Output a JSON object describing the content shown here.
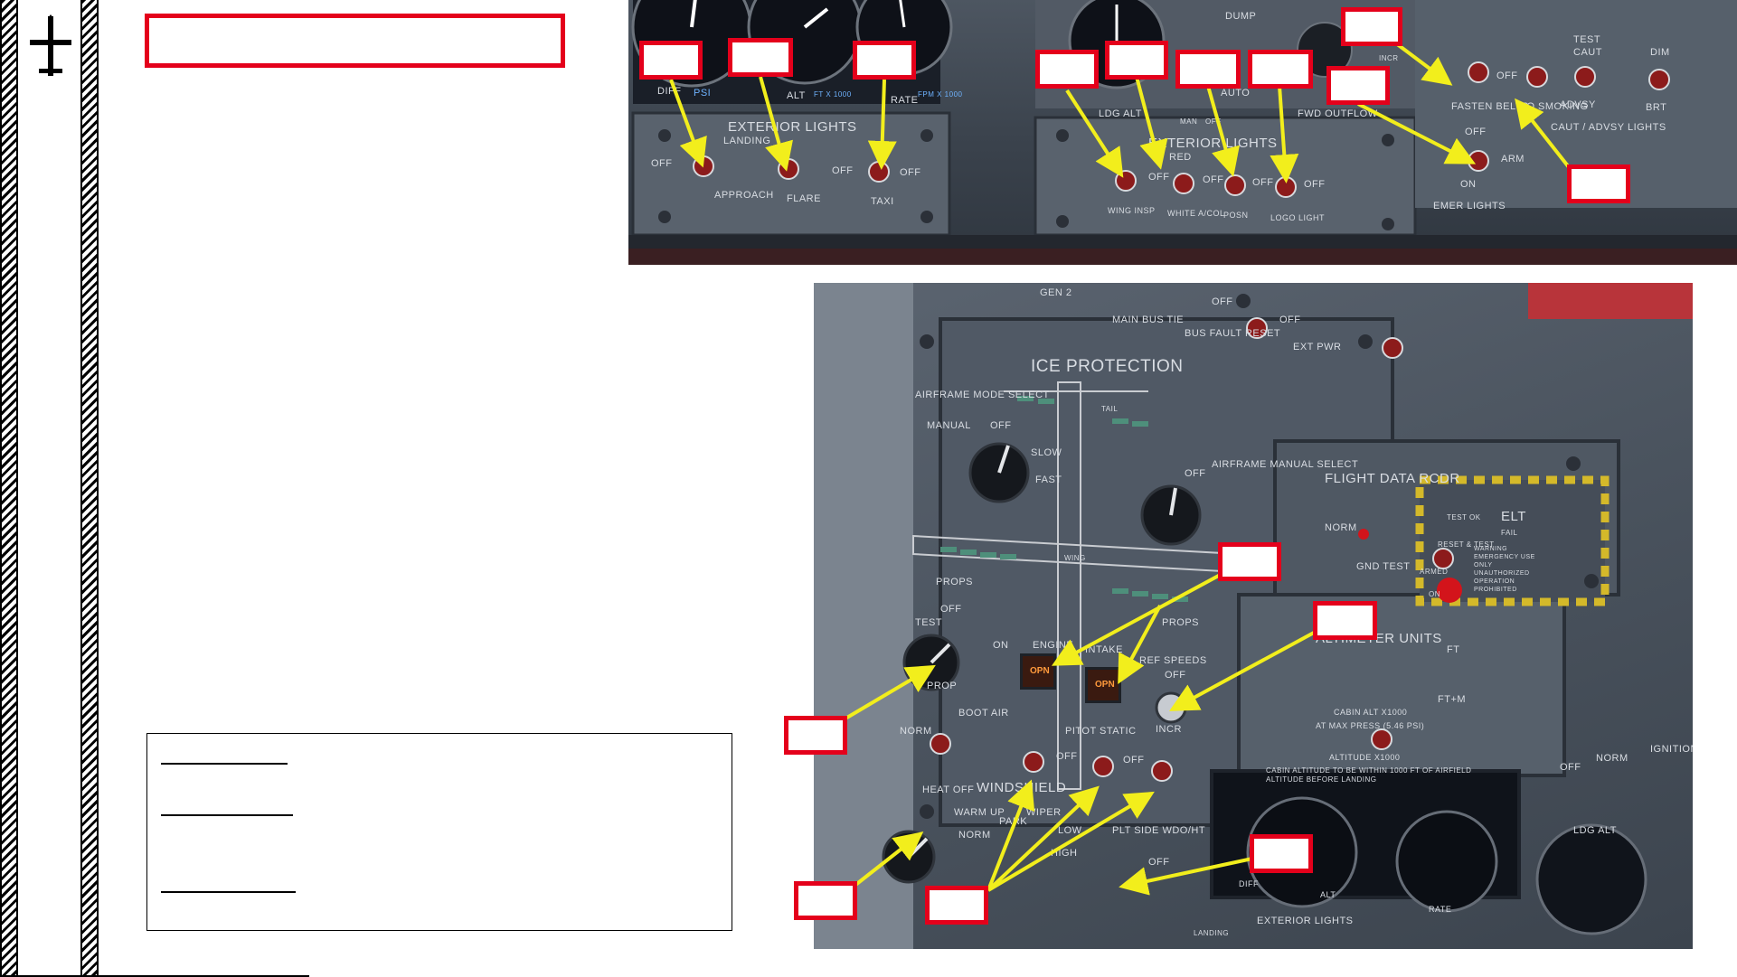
{
  "page": {
    "logo_icon": "airplane-icon"
  },
  "panel_top": {
    "gauges": {
      "gauge1_unit": "PSI",
      "gauge1_diff": "DIFF",
      "gauge2_label": "ALT",
      "gauge2_unit": "FT X 1000",
      "gauge3_label": "RATE",
      "gauge3_unit": "FPM X 1000"
    },
    "exterior_lights_left": {
      "title": "EXTERIOR LIGHTS",
      "landing": "LANDING",
      "off1": "OFF",
      "approach": "APPROACH",
      "flare": "FLARE",
      "off2": "OFF",
      "off3": "OFF",
      "taxi": "TAXI"
    },
    "cabin_pressure": {
      "dump": "DUMP",
      "auto": "AUTO",
      "man": "MAN",
      "off": "OFF",
      "ldg_alt": "LDG ALT",
      "fwd_outflow": "FWD OUTFLOW",
      "incr": "INCR"
    },
    "exterior_lights_right": {
      "title": "EXTERIOR LIGHTS",
      "red": "RED",
      "off1": "OFF",
      "off2": "OFF",
      "off3": "OFF",
      "off4": "OFF",
      "wing_insp": "WING INSP",
      "white_acol": "WHITE A/COL",
      "posn": "POSN",
      "logo_light": "LOGO LIGHT"
    },
    "signs": {
      "off": "OFF",
      "fasten_belts": "FASTEN BELTS",
      "no_smoking": "NO SMOKING",
      "test": "TEST",
      "caut": "CAUT",
      "dim": "DIM",
      "advsy": "ADVSY",
      "brt": "BRT",
      "caut_advsy_lights": "CAUT / ADVSY LIGHTS",
      "emer_off": "OFF",
      "arm": "ARM",
      "on": "ON",
      "emer_lights": "EMER LIGHTS"
    }
  },
  "panel_bottom": {
    "electrical": {
      "gen2": "GEN 2",
      "main_bus_tie": "MAIN BUS TIE",
      "bus_fault_reset": "BUS FAULT RESET",
      "ext_pwr": "EXT PWR",
      "off1": "OFF",
      "off2": "OFF"
    },
    "ice_protection": {
      "title": "ICE PROTECTION",
      "airframe_mode_select": "AIRFRAME MODE SELECT",
      "manual": "MANUAL",
      "off": "OFF",
      "slow": "SLOW",
      "fast": "FAST",
      "tail": "TAIL",
      "wing": "WING",
      "airframe_manual_select": "AIRFRAME MANUAL SELECT",
      "off2": "OFF",
      "props": "PROPS",
      "props2": "PROPS",
      "test": "TEST",
      "props_off": "OFF",
      "on": "ON",
      "prop": "PROP",
      "engine": "ENGINE",
      "intake": "INTAKE",
      "opn": "OPN",
      "ref_speeds": "REF SPEEDS",
      "ref_off": "OFF",
      "incr": "INCR",
      "boot_air": "BOOT AIR",
      "norm": "NORM",
      "pitot_static": "PITOT STATIC",
      "off3": "OFF",
      "off4": "OFF",
      "windshield": "WINDSHIELD",
      "heat_off": "HEAT OFF",
      "warm_up": "WARM UP",
      "norm2": "NORM",
      "wiper": "WIPER",
      "low": "LOW",
      "high": "HIGH",
      "park": "PARK",
      "plt_side_wdo_ht": "PLT SIDE WDO/HT",
      "off5": "OFF"
    },
    "flight_data": {
      "title": "FLIGHT DATA RCDR",
      "norm": "NORM",
      "gnd_test": "GND TEST"
    },
    "elt": {
      "title": "ELT",
      "test_ok": "TEST OK",
      "fail": "FAIL",
      "reset_test": "RESET & TEST",
      "armed": "ARMED",
      "on": "ON",
      "warning": "WARNING EMERGENCY USE ONLY UNAUTHORIZED OPERATION PROHIBITED"
    },
    "altimeter": {
      "title": "ALTIMETER UNITS",
      "ft": "FT",
      "ft_m": "FT+M",
      "cabin_alt": "CABIN ALT X1000",
      "at_max_press": "AT MAX PRESS (5.46 PSI)",
      "altitude": "ALTITUDE X1000",
      "note": "CABIN ALTITUDE TO BE WITHIN 1000 FT OF AIRFIELD ALTITUDE BEFORE LANDING"
    },
    "lower_gauge": {
      "diff": "DIFF",
      "alt": "ALT",
      "rate": "RATE",
      "exterior_lights": "EXTERIOR LIGHTS",
      "landing": "LANDING"
    },
    "right_side": {
      "norm": "NORM",
      "ignition": "IGNITION",
      "off": "OFF",
      "ldg_alt": "LDG ALT"
    }
  },
  "colors": {
    "callout_border": "#e4001b",
    "arrow": "#f2ee1c",
    "panel": "#4a535e"
  }
}
